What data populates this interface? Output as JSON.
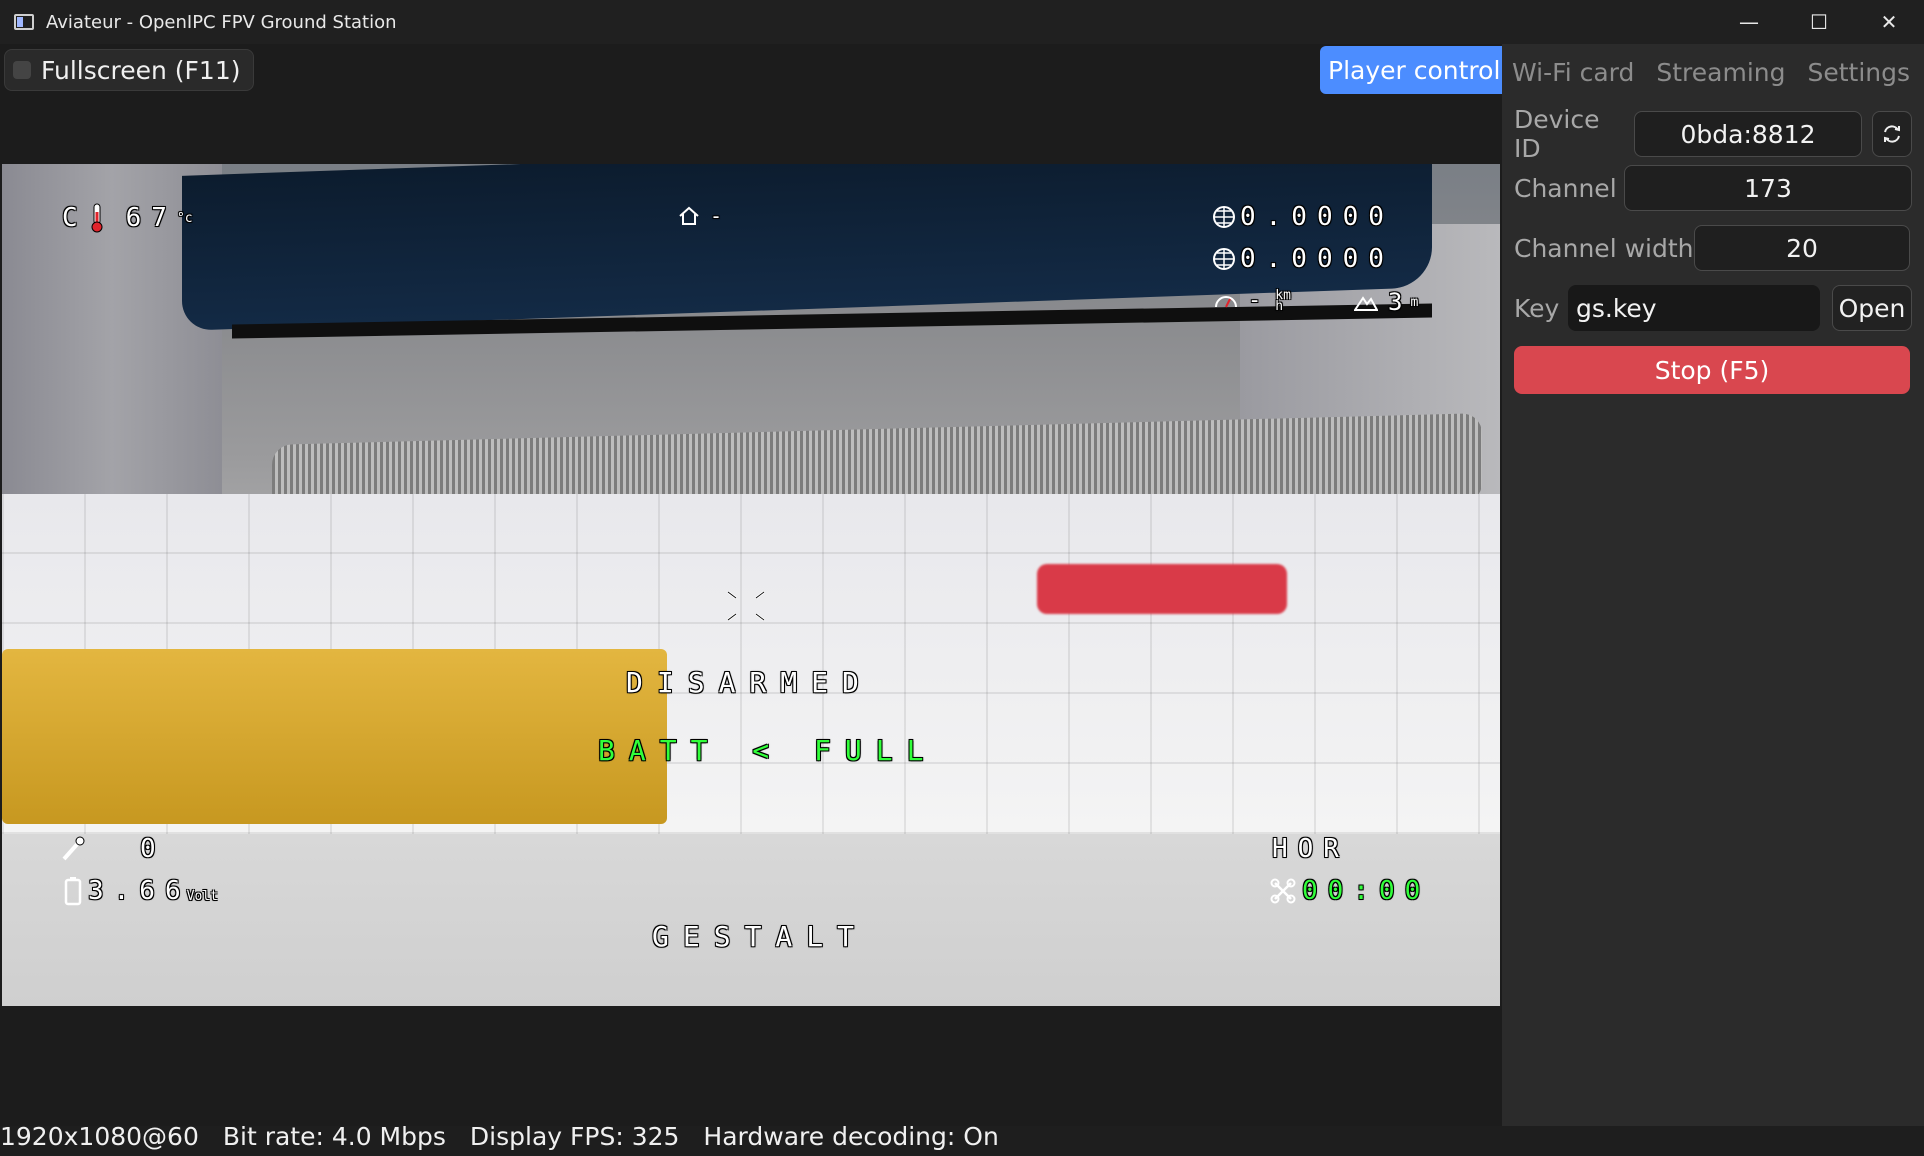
{
  "window": {
    "title": "Aviateur - OpenIPC FPV Ground Station",
    "controls": {
      "minimize": "—",
      "maximize": "☐",
      "close": "✕"
    }
  },
  "toolbar": {
    "fullscreen_label": "Fullscreen (F11)",
    "fullscreen_checked": false
  },
  "tabs": [
    {
      "label": "Player control",
      "active": true
    },
    {
      "label": "Wi-Fi card",
      "active": false
    },
    {
      "label": "Streaming",
      "active": false
    },
    {
      "label": "Settings",
      "active": false
    }
  ],
  "wifi": {
    "device_id_label": "Device ID",
    "device_id_value": "0bda:8812",
    "refresh_icon": "refresh-icon",
    "channel_label": "Channel",
    "channel_value": "173",
    "channel_width_label": "Channel width",
    "channel_width_value": "20",
    "key_label": "Key",
    "key_value": "gs.key",
    "open_label": "Open",
    "stop_label": "Stop (F5)"
  },
  "osd": {
    "temp_prefix": "C",
    "temp_value": "67",
    "temp_unit": "°c",
    "home_dist": "-",
    "lat": "0.0000",
    "lon": "0.0000",
    "speed": "-",
    "speed_unit_top": "km",
    "speed_unit_bottom": "h",
    "alt": "3",
    "alt_unit": "m",
    "disarmed": "DISARMED",
    "batt": "BATT < FULL",
    "throttle": "0",
    "voltage": "3.66",
    "voltage_unit": "Volt",
    "mode": "HOR",
    "flight_time": "00:00",
    "craft_name": "GESTALT"
  },
  "status": {
    "resolution": "1920x1080@60",
    "bitrate": "Bit rate: 4.0 Mbps",
    "display_fps": "Display FPS: 325",
    "hw_decoding": "Hardware decoding: On"
  },
  "colors": {
    "accent": "#4c8dff",
    "stop": "#d9474f",
    "osd_green": "#31ff3a"
  }
}
